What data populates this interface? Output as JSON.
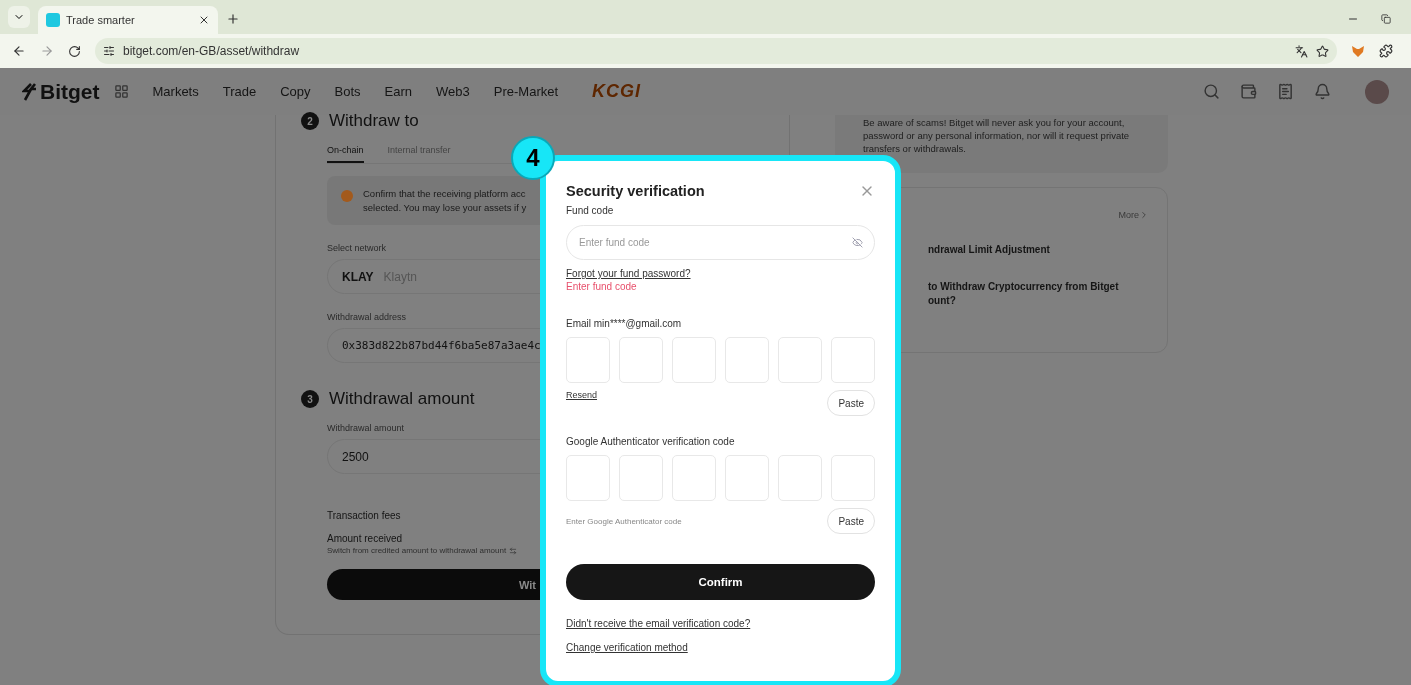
{
  "browser": {
    "tab_title": "Trade smarter",
    "url": "bitget.com/en-GB/asset/withdraw"
  },
  "header": {
    "logo": "Bitget",
    "nav": [
      "Markets",
      "Trade",
      "Copy",
      "Bots",
      "Earn",
      "Web3",
      "Pre-Market"
    ],
    "partner_logo": "KCGI"
  },
  "withdraw": {
    "step2": {
      "number": "2",
      "title": "Withdraw to"
    },
    "tabs": [
      {
        "label": "On-chain",
        "selected": true
      },
      {
        "label": "Internal transfer",
        "selected": false
      }
    ],
    "warning": [
      "Confirm that the receiving platform acc",
      "selected. You may lose your assets if y"
    ],
    "network_label": "Select network",
    "network_symbol": "KLAY",
    "network_name": "Klaytn",
    "address_label": "Withdrawal address",
    "address": "0x383d822b87bd44f6ba5e87a3ae4c",
    "step3": {
      "number": "3",
      "title": "Withdrawal amount"
    },
    "amount_label": "Withdrawal amount",
    "amount": "2500",
    "fees_label": "Transaction fees",
    "received_label": "Amount received",
    "switch_hint": "Switch from credited amount to withdrawal amount",
    "button": "Wit"
  },
  "side": {
    "notice": "Be aware of scams! Bitget will never ask you for your account, password or any personal information, nor will it request private transfers or withdrawals.",
    "more": "More",
    "articles": [
      "ndrawal Limit Adjustment",
      "to Withdraw Cryptocurrency from Bitget",
      "ount?"
    ]
  },
  "step_badge": "4",
  "dialog": {
    "title": "Security verification",
    "fund_label": "Fund code",
    "fund_placeholder": "Enter fund code",
    "forgot": "Forgot your fund password?",
    "error": "Enter fund code",
    "email_label": "Email min****@gmail.com",
    "resend": "Resend",
    "paste": "Paste",
    "ga_label": "Google Authenticator verification code",
    "ga_hint": "Enter Google Authenticator code",
    "ga_paste": "Paste",
    "confirm": "Confirm",
    "links": [
      "Didn't receive the email verification code?",
      "Change verification method"
    ]
  }
}
